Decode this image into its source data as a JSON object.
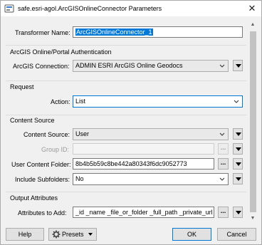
{
  "window": {
    "title": "safe.esri-agol.ArcGISOnlineConnector Parameters"
  },
  "transformer": {
    "name_label": "Transformer Name:",
    "name_value": "ArcGISOnlineConnector_1"
  },
  "auth": {
    "group_title": "ArcGIS Online/Portal Authentication",
    "connection_label": "ArcGIS Connection:",
    "connection_value": "ADMIN ESRI ArcGIS Online Geodocs"
  },
  "request": {
    "group_title": "Request",
    "action_label": "Action:",
    "action_value": "List"
  },
  "content_source": {
    "group_title": "Content Source",
    "source_label": "Content Source:",
    "source_value": "User",
    "group_id_label": "Group ID:",
    "group_id_value": "",
    "folder_label": "User Content Folder:",
    "folder_value": "8b4b5b59c8be442a80343f6dc9052773",
    "subfolders_label": "Include Subfolders:",
    "subfolders_value": "No",
    "ellipsis_label": "..."
  },
  "output": {
    "group_title": "Output Attributes",
    "attributes_label": "Attributes to Add:",
    "attributes_value": "_id _name _file_or_folder _full_path _private_url",
    "ellipsis_label": "..."
  },
  "footer": {
    "help_label": "Help",
    "presets_label": "Presets",
    "ok_label": "OK",
    "cancel_label": "Cancel"
  },
  "icons": {
    "app": "fme-transformer-icon",
    "close": "close-icon",
    "dropdown": "chevron-down-icon",
    "menu": "triangle-down-icon",
    "presets": "gear-icon"
  }
}
